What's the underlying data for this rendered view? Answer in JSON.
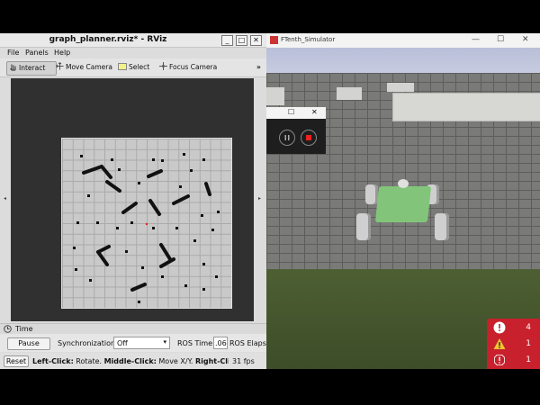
{
  "rviz": {
    "title": "graph_planner.rviz* - RViz",
    "title_buttons": [
      "_",
      "□",
      "✕"
    ],
    "menu": [
      "File",
      "Panels",
      "Help"
    ],
    "tools": [
      {
        "label": "Interact",
        "icon": "hand-cursor-icon",
        "active": true
      },
      {
        "label": "Move Camera",
        "icon": "move-camera-icon",
        "active": false
      },
      {
        "label": "Select",
        "icon": "select-box-icon",
        "active": false
      },
      {
        "label": "Focus Camera",
        "icon": "focus-camera-icon",
        "active": false
      }
    ],
    "toolbar_overflow": "»",
    "time_panel": {
      "title": "Time",
      "pause_label": "Pause",
      "sync_label": "Synchronization:",
      "sync_value": "Off",
      "ros_time_label": "ROS Time:",
      "ros_time_value": ".06",
      "ros_elapsed_label": "ROS Elapse"
    },
    "status": {
      "reset_label": "Reset",
      "hint_bold1": "Left-Click:",
      "hint1": " Rotate. ",
      "hint_bold2": "Middle-Click:",
      "hint2": " Move X/Y. ",
      "hint_bold3": "Right-Click/Mo",
      "fps": "31 fps"
    }
  },
  "simulator": {
    "title": "FTenth_Simulator",
    "window_buttons": [
      "—",
      "☐",
      "✕"
    ],
    "popup_buttons": [
      "☐",
      "✕"
    ]
  },
  "alerts": [
    {
      "icon": "error-icon",
      "count": "4"
    },
    {
      "icon": "warning-icon",
      "count": "1"
    },
    {
      "icon": "critical-icon",
      "count": "1"
    }
  ],
  "colors": {
    "map_bg": "#c9c9c9",
    "viewport_bg": "#303030",
    "car_body": "#82c57a",
    "alert_bg": "#c8202c",
    "sky": "#aab1d1"
  }
}
